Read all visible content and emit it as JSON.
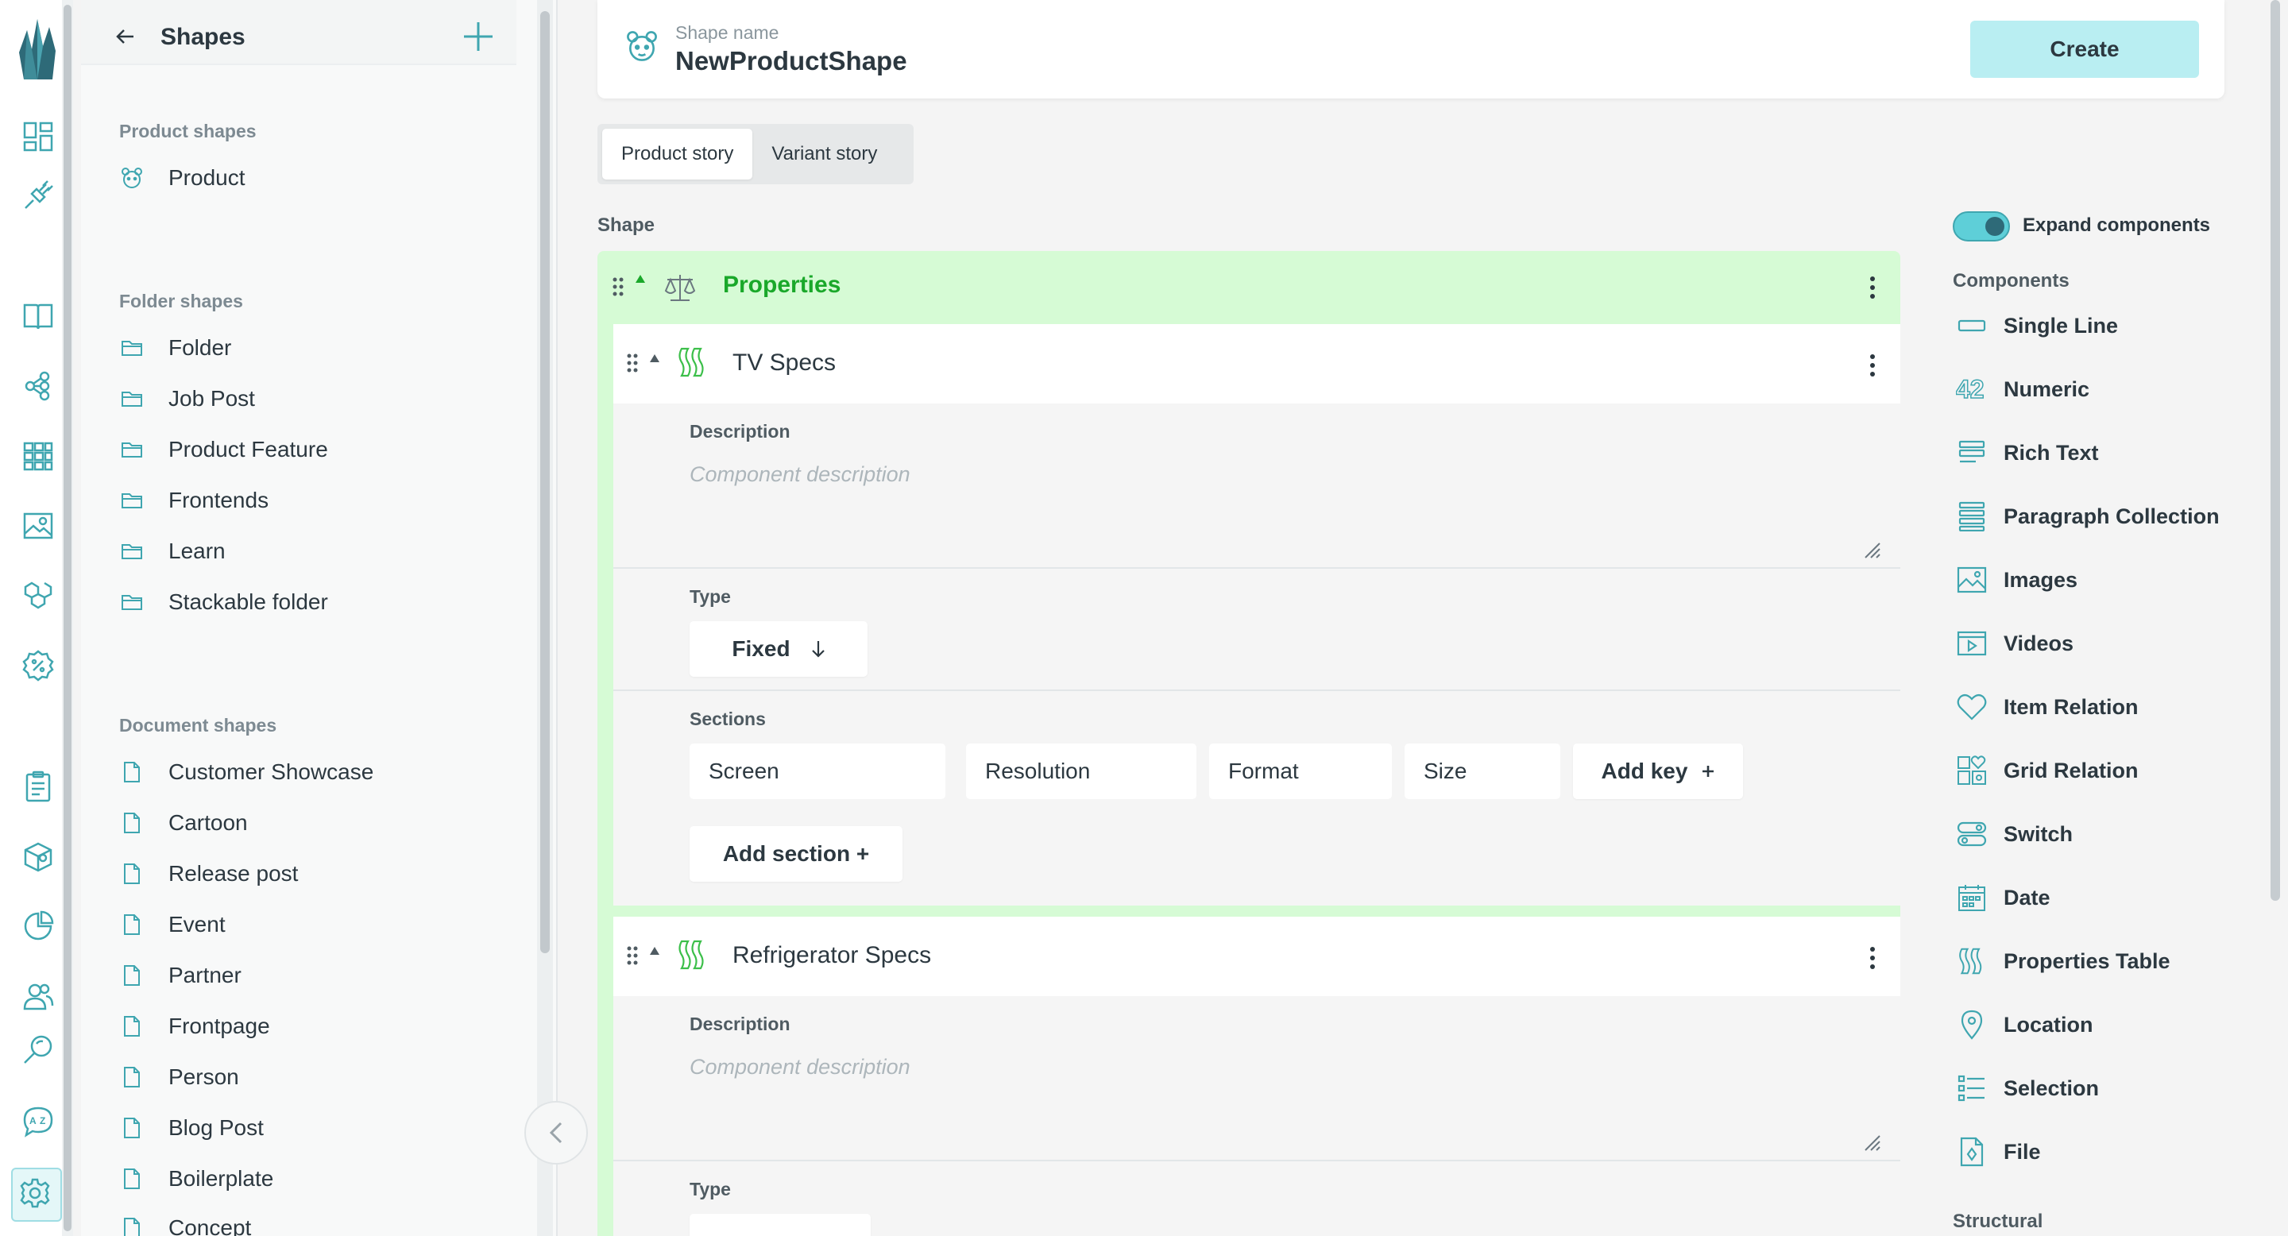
{
  "sidebar": {
    "title": "Shapes",
    "sections": [
      {
        "label": "Product shapes",
        "items": [
          "Product"
        ]
      },
      {
        "label": "Folder shapes",
        "items": [
          "Folder",
          "Job Post",
          "Product Feature",
          "Frontends",
          "Learn",
          "Stackable folder"
        ]
      },
      {
        "label": "Document shapes",
        "items": [
          "Customer Showcase",
          "Cartoon",
          "Release post",
          "Event",
          "Partner",
          "Frontpage",
          "Person",
          "Blog Post",
          "Boilerplate",
          "Concept"
        ]
      }
    ]
  },
  "rail_icons": [
    "logo-icon",
    "dashboard-icon",
    "plug-icon",
    "book-icon",
    "topics-icon",
    "catalogue-grid-icon",
    "image-icon",
    "grid-relations-icon",
    "discount-icon",
    "orders-icon",
    "box-icon",
    "analytics-icon",
    "users-icon",
    "search-icon",
    "translate-icon",
    "settings-icon"
  ],
  "shape": {
    "name_label": "Shape name",
    "name": "NewProductShape",
    "create_label": "Create",
    "tabs": [
      "Product story",
      "Variant story"
    ],
    "active_tab": 0,
    "section_label": "Shape",
    "properties_title": "Properties"
  },
  "components": [
    {
      "title": "TV Specs",
      "description_label": "Description",
      "description_placeholder": "Component description",
      "type_label": "Type",
      "type_value": "Fixed",
      "sections_label": "Sections",
      "keys": [
        "Screen",
        "Resolution",
        "Format",
        "Size"
      ],
      "add_key_label": "Add key",
      "add_section_label": "Add section +"
    },
    {
      "title": "Refrigerator Specs",
      "description_label": "Description",
      "description_placeholder": "Component description",
      "type_label": "Type"
    }
  ],
  "panel": {
    "expand_label": "Expand components",
    "expand_on": true,
    "components_heading": "Components",
    "items": [
      "Single Line",
      "Numeric",
      "Rich Text",
      "Paragraph Collection",
      "Images",
      "Videos",
      "Item Relation",
      "Grid Relation",
      "Switch",
      "Date",
      "Properties Table",
      "Location",
      "Selection",
      "File"
    ],
    "structural_heading": "Structural"
  },
  "colors": {
    "accent": "#5ecfd8",
    "properties_bg": "#d6fbd5",
    "properties_title": "#1aa82a",
    "create_button": "#b9eef2"
  }
}
